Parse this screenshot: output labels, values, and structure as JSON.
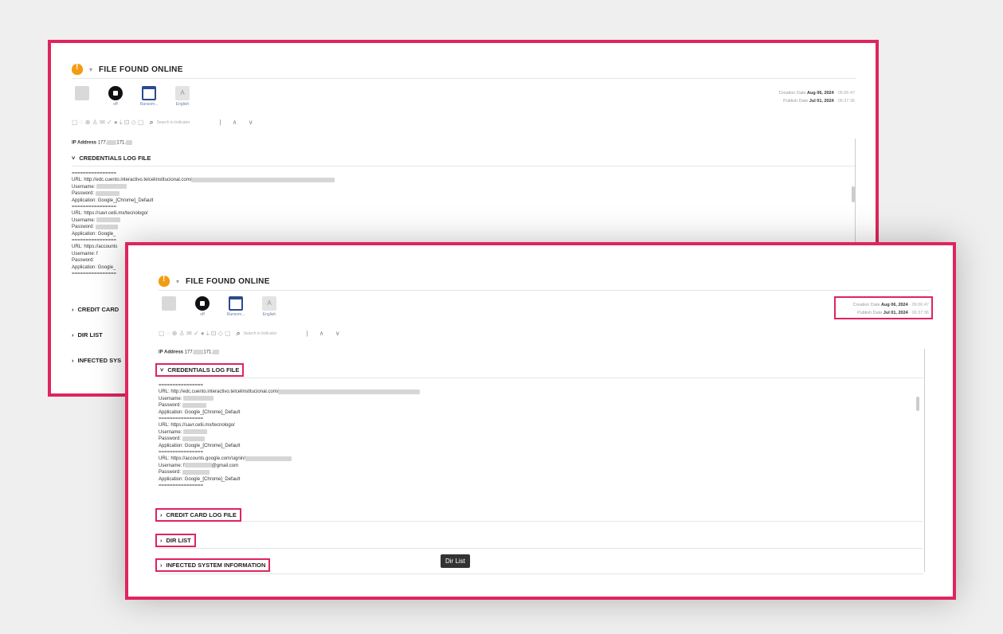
{
  "header": {
    "title": "FILE FOUND ONLINE"
  },
  "tools": [
    {
      "icon": "note-icon",
      "label": ""
    },
    {
      "icon": "lock-icon",
      "label": "off"
    },
    {
      "icon": "window-icon",
      "label": "Ransom..."
    },
    {
      "icon": "language-icon",
      "label": "English"
    }
  ],
  "dates": {
    "creation_label": "Creation Date",
    "creation_date": "Aug 06, 2024",
    "creation_time": "· 06:06:47",
    "publish_label": "Publish Date",
    "publish_date": "Jul 01, 2024",
    "publish_time": "· 06:37:36"
  },
  "search": {
    "placeholder": "Search in Indicator"
  },
  "ip": {
    "label": "IP Address",
    "value": "177.",
    "value2": "171."
  },
  "sections": {
    "credentials": "CREDENTIALS LOG FILE",
    "credit_card": "CREDIT CARD LOG FILE",
    "dir_list": "DIR LIST",
    "infected": "INFECTED SYSTEM INFORMATION",
    "credit_card_cut": "CREDIT CARD",
    "infected_cut": "INFECTED SYS"
  },
  "log": {
    "sep": "================",
    "entry1": {
      "url": "URL: http://edc.cuento.interactivo.telcelinstitucional.com/",
      "user": "Username:",
      "pass": "Password:",
      "app": "Application: Google_[Chrome]_Default"
    },
    "entry2": {
      "url_back": "URL: https://savr.cetii.mx/tecnologo/",
      "url_front": "URL: https://savr.cetii.mx/tecnologo/",
      "user": "Username:",
      "pass": "Password:",
      "app": "Application: Google_[Chrome]_Default"
    },
    "entry3": {
      "url": "URL: https://accounts.google.com/signin/",
      "url_cut": "URL: https://accounts",
      "user": "Username: f",
      "user_suffix": "@gmail.com",
      "pass": "Password:",
      "app": "Application: Google_[Chrome]_Default",
      "app_cut": "Application: Google_"
    },
    "app_cut2": "Application: Google"
  },
  "tooltip": "Dir List"
}
